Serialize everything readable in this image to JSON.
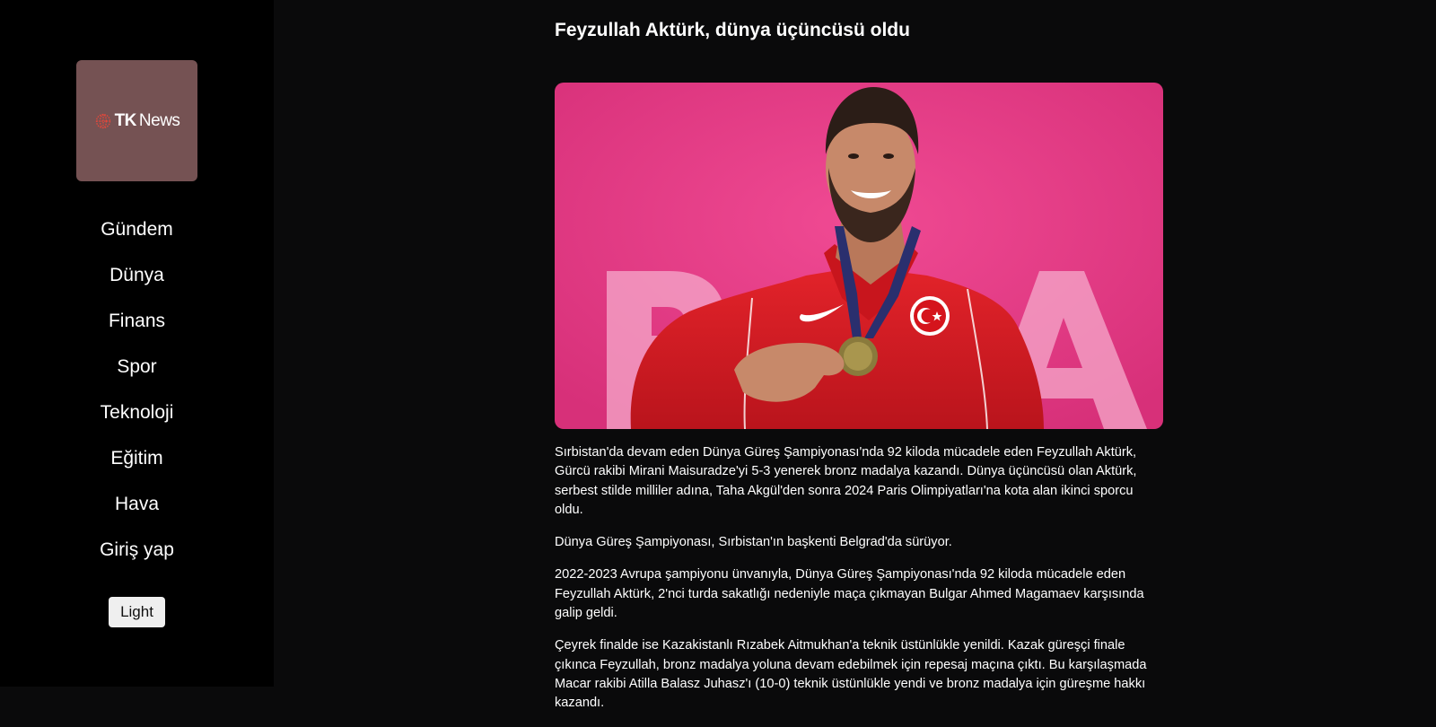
{
  "brand": {
    "logo_tk": "TK",
    "logo_news": "News",
    "accent_color": "#e5473b",
    "logo_bg_color": "#755253"
  },
  "nav": {
    "items": [
      {
        "label": "Gündem"
      },
      {
        "label": "Dünya"
      },
      {
        "label": "Finans"
      },
      {
        "label": "Spor"
      },
      {
        "label": "Teknoloji"
      },
      {
        "label": "Eğitim"
      },
      {
        "label": "Hava"
      },
      {
        "label": "Giriş yap"
      }
    ]
  },
  "theme_toggle": {
    "label": "Light"
  },
  "article": {
    "title": "Feyzullah Aktürk, dünya üçüncüsü oldu",
    "paragraphs": [
      "Sırbistan'da devam eden Dünya Güreş Şampiyonası'nda 92 kiloda mücadele eden Feyzullah Aktürk, Gürcü rakibi Mirani Maisuradze'yi 5-3 yenerek bronz madalya kazandı. Dünya üçüncüsü olan Aktürk, serbest stilde milliler adına, Taha Akgül'den sonra 2024 Paris Olimpiyatları'na kota alan ikinci sporcu oldu.",
      "Dünya Güreş Şampiyonası, Sırbistan'ın başkenti Belgrad'da sürüyor.",
      "2022-2023 Avrupa şampiyonu ünvanıyla, Dünya Güreş Şampiyonası'nda 92 kiloda mücadele eden Feyzullah Aktürk, 2'nci turda sakatlığı nedeniyle maça çıkmayan Bulgar Ahmed Magamaev karşısında galip geldi.",
      "Çeyrek finalde ise Kazakistanlı Rızabek Aitmukhan'a teknik üstünlükle yenildi. Kazak güreşçi finale çıkınca Feyzullah, bronz madalya yoluna devam edebilmek için repesaj maçına çıktı. Bu karşılaşmada Macar rakibi Atilla Balasz Juhasz'ı (10-0) teknik üstünlükle yendi ve bronz madalya için güreşme hakkı kazandı."
    ],
    "hero_image": {
      "icon": "wrestler-photo",
      "bg_color": "#e43d83"
    }
  }
}
